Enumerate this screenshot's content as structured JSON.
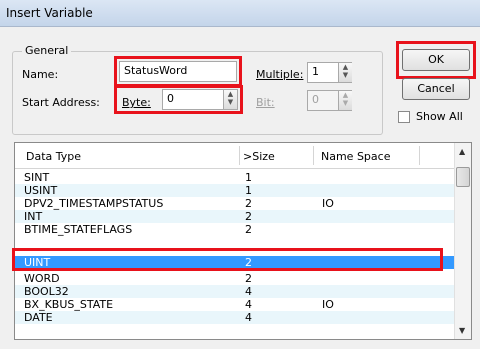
{
  "window": {
    "title": "Insert Variable"
  },
  "general": {
    "legend": "General",
    "name_label": "Name:",
    "name_value": "StatusWord",
    "multiple_label": "Multiple:",
    "multiple_value": "1",
    "start_address_label": "Start Address:",
    "byte_label": "Byte:",
    "byte_value": "0",
    "bit_label": "Bit:",
    "bit_value": "0"
  },
  "buttons": {
    "ok": "OK",
    "cancel": "Cancel"
  },
  "show_all": {
    "label": "Show All",
    "checked": false
  },
  "table": {
    "columns": [
      "Data Type",
      ">Size",
      "Name Space"
    ],
    "rows": [
      {
        "type": "SINT",
        "size": "1",
        "ns": ""
      },
      {
        "type": "USINT",
        "size": "1",
        "ns": ""
      },
      {
        "type": "DPV2_TIMESTAMPSTATUS",
        "size": "2",
        "ns": "IO"
      },
      {
        "type": "INT",
        "size": "2",
        "ns": ""
      },
      {
        "type": "BTIME_STATEFLAGS",
        "size": "2",
        "ns": ""
      },
      {
        "type": "UINT",
        "size": "2",
        "ns": ""
      },
      {
        "type": "WORD",
        "size": "2",
        "ns": ""
      },
      {
        "type": "BOOL32",
        "size": "4",
        "ns": ""
      },
      {
        "type": "BX_KBUS_STATE",
        "size": "4",
        "ns": "IO"
      },
      {
        "type": "DATE",
        "size": "4",
        "ns": ""
      }
    ],
    "selected_index": 5
  },
  "colors": {
    "highlight": "#e8121b",
    "selection": "#3399ff",
    "alt_row": "#e9f6fb"
  }
}
